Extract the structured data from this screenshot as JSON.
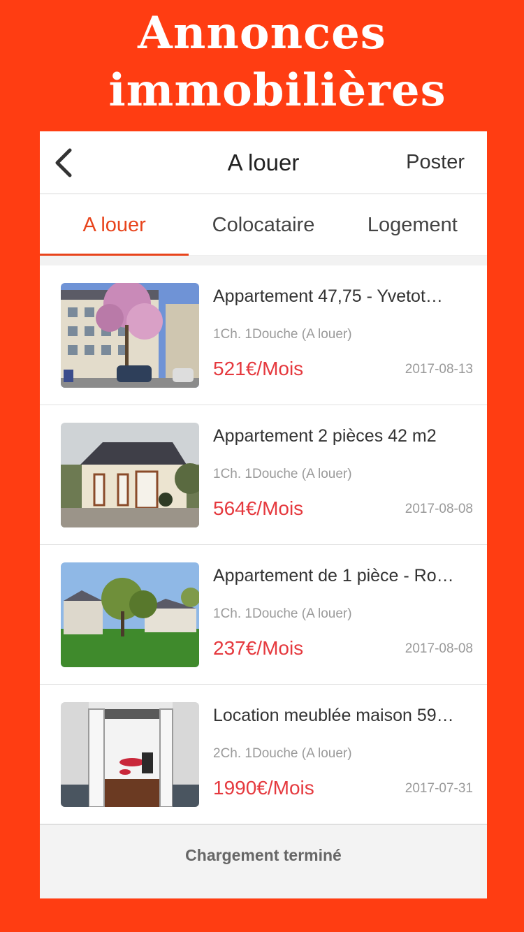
{
  "promo": {
    "line1": "Annonces",
    "line2": "immobilières"
  },
  "navbar": {
    "back_icon": "chevron-left-icon",
    "title": "A louer",
    "action": "Poster"
  },
  "tabs": [
    {
      "label": "A louer",
      "active": true
    },
    {
      "label": "Colocataire",
      "active": false
    },
    {
      "label": "Logement",
      "active": false
    }
  ],
  "listings": [
    {
      "title": "Appartement 47,75 - Yvetot…",
      "details": "1Ch. 1Douche (A louer)",
      "price": "521€/Mois",
      "date": "2017-08-13"
    },
    {
      "title": "Appartement 2 pièces 42 m2",
      "details": "1Ch. 1Douche (A louer)",
      "price": "564€/Mois",
      "date": "2017-08-08"
    },
    {
      "title": "Appartement de 1 pièce - Ro…",
      "details": "1Ch. 1Douche (A louer)",
      "price": "237€/Mois",
      "date": "2017-08-08"
    },
    {
      "title": "Location meublée maison 59…",
      "details": "2Ch. 1Douche (A louer)",
      "price": "1990€/Mois",
      "date": "2017-07-31"
    }
  ],
  "footer": {
    "status": "Chargement terminé"
  },
  "colors": {
    "background": "#ff3d12",
    "accent": "#e8441c",
    "price": "#e5393e"
  }
}
